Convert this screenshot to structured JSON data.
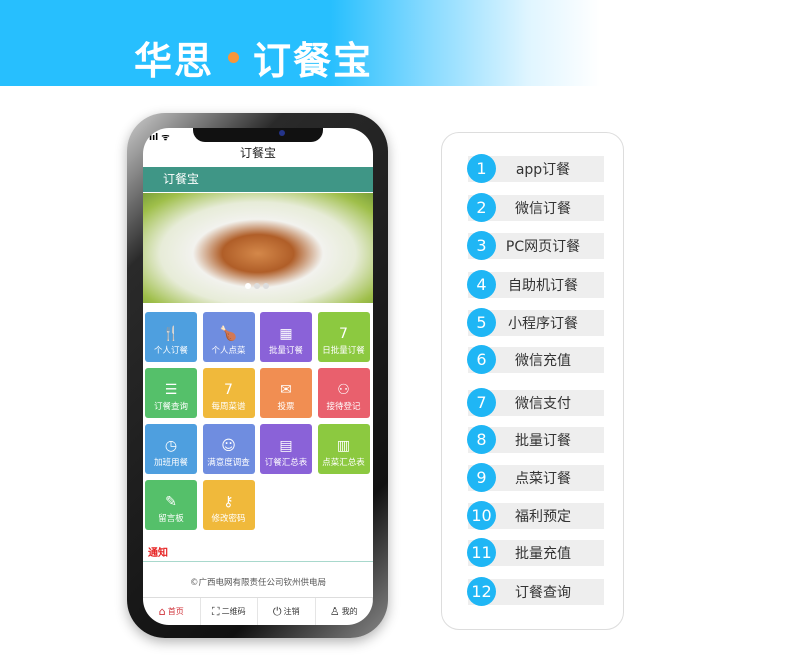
{
  "banner": {
    "title_left": "华思",
    "title_right": "订餐宝",
    "dot_color": "#f7963a"
  },
  "phone": {
    "app_title": "订餐宝",
    "appbar_title": "订餐宝",
    "signal": "ııl ᯤ",
    "tiles": [
      {
        "label": "个人订餐",
        "icon": "fork-knife-icon",
        "glyph": "🍴",
        "color": "#4e9fdf"
      },
      {
        "label": "个人点菜",
        "icon": "drumstick-icon",
        "glyph": "🍗",
        "color": "#6f8de0"
      },
      {
        "label": "批量订餐",
        "icon": "calendar-grid-icon",
        "glyph": "▦",
        "color": "#8a62d8"
      },
      {
        "label": "日批量订餐",
        "icon": "calendar-day-icon",
        "glyph": "7",
        "color": "#8cc940"
      },
      {
        "label": "订餐查询",
        "icon": "document-search-icon",
        "glyph": "☰",
        "color": "#55c06a"
      },
      {
        "label": "每周菜谱",
        "icon": "calendar-week-icon",
        "glyph": "7",
        "color": "#f0b93b"
      },
      {
        "label": "投票",
        "icon": "ballot-icon",
        "glyph": "✉",
        "color": "#f18e52"
      },
      {
        "label": "接待登记",
        "icon": "people-icon",
        "glyph": "⚇",
        "color": "#e9606d"
      },
      {
        "label": "加班用餐",
        "icon": "clock-icon",
        "glyph": "◷",
        "color": "#4e9fdf"
      },
      {
        "label": "满意度调查",
        "icon": "smiley-icon",
        "glyph": "☺",
        "color": "#6f8de0"
      },
      {
        "label": "订餐汇总表",
        "icon": "clipboard-chart-icon",
        "glyph": "▤",
        "color": "#8a62d8"
      },
      {
        "label": "点菜汇总表",
        "icon": "report-icon",
        "glyph": "▥",
        "color": "#8cc940"
      },
      {
        "label": "留言板",
        "icon": "edit-icon",
        "glyph": "✎",
        "color": "#55c06a"
      },
      {
        "label": "修改密码",
        "icon": "key-icon",
        "glyph": "⚷",
        "color": "#f0b93b"
      }
    ],
    "notice": "通知",
    "footer": "©广西电网有限责任公司钦州供电局",
    "tabs": [
      {
        "label": "首页",
        "icon": "home-icon",
        "glyph": "⌂",
        "active": true
      },
      {
        "label": "二维码",
        "icon": "qr-code-icon",
        "glyph": "⛶",
        "active": false
      },
      {
        "label": "注销",
        "icon": "power-icon",
        "glyph": "⏻",
        "active": false
      },
      {
        "label": "我的",
        "icon": "user-icon",
        "glyph": "♙",
        "active": false
      }
    ]
  },
  "features": [
    {
      "num": "1",
      "label": "app订餐"
    },
    {
      "num": "2",
      "label": "微信订餐"
    },
    {
      "num": "3",
      "label": "PC网页订餐"
    },
    {
      "num": "4",
      "label": "自助机订餐"
    },
    {
      "num": "5",
      "label": "小程序订餐"
    },
    {
      "num": "6",
      "label": "微信充值"
    },
    {
      "num": "7",
      "label": "微信支付"
    },
    {
      "num": "8",
      "label": "批量订餐"
    },
    {
      "num": "9",
      "label": "点菜订餐"
    },
    {
      "num": "10",
      "label": "福利预定"
    },
    {
      "num": "11",
      "label": "批量充值"
    },
    {
      "num": "12",
      "label": "订餐查询"
    }
  ]
}
